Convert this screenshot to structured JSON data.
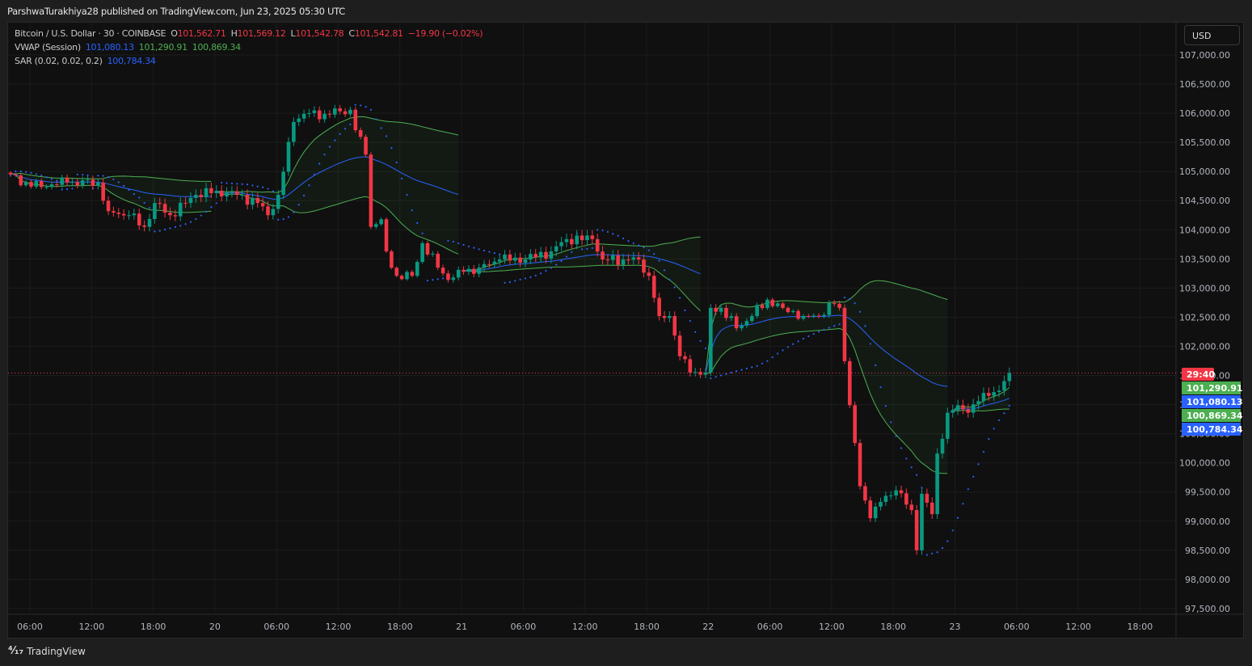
{
  "header": {
    "published": "ParshwaTurakhiya28 published on TradingView.com, Jun 23, 2025 05:30 UTC"
  },
  "legend": {
    "symbol": "Bitcoin / U.S. Dollar · 30 · COINBASE",
    "o_label": "O",
    "o": "101,562.71",
    "h_label": "H",
    "h": "101,569.12",
    "l_label": "L",
    "l": "101,542.78",
    "c_label": "C",
    "c": "101,542.81",
    "change": "−19.90 (−0.02%)",
    "vwap_label": "VWAP (Session)",
    "vwap": "101,080.13",
    "vwap_upper": "101,290.91",
    "vwap_lower": "100,869.34",
    "sar_label": "SAR (0.02, 0.02, 0.2)",
    "sar": "100,784.34"
  },
  "currency_button": "USD",
  "price_tags": {
    "countdown": "29:40",
    "vwap_upper": "101,290.91",
    "vwap": "101,080.13",
    "vwap_lower": "100,869.34",
    "sar": "100,784.34"
  },
  "colors": {
    "up": "#089981",
    "down": "#f23645",
    "vwap": "#2962ff",
    "band": "#4caf50",
    "sar": "#2962ff",
    "bg": "#101010"
  },
  "footer": {
    "brand": "TradingView"
  },
  "chart_data": {
    "type": "candlestick",
    "interval": "30m",
    "ylim": [
      97500,
      107250
    ],
    "y_ticks": [
      "107,000.00",
      "106,500.00",
      "106,000.00",
      "105,500.00",
      "105,000.00",
      "104,500.00",
      "104,000.00",
      "103,500.00",
      "103,000.00",
      "102,500.00",
      "102,000.00",
      "101,500.00",
      "101,000.00",
      "100,500.00",
      "100,000.00",
      "99,500.00",
      "99,000.00",
      "98,500.00",
      "98,000.00",
      "97,500.00"
    ],
    "x_ticks": [
      "06:00",
      "12:00",
      "18:00",
      "20",
      "06:00",
      "12:00",
      "18:00",
      "21",
      "06:00",
      "12:00",
      "18:00",
      "22",
      "06:00",
      "12:00",
      "18:00",
      "23",
      "06:00",
      "12:00",
      "18:00"
    ],
    "session_starts": [
      40,
      88,
      135,
      183
    ],
    "last_price": 101542.81,
    "close_keypoints": [
      [
        0,
        104950
      ],
      [
        4,
        104740
      ],
      [
        11,
        104810
      ],
      [
        17,
        104810
      ],
      [
        19,
        104320
      ],
      [
        23,
        104250
      ],
      [
        26,
        104050
      ],
      [
        28,
        104460
      ],
      [
        31,
        104250
      ],
      [
        36,
        104600
      ],
      [
        40,
        104670
      ],
      [
        44,
        104600
      ],
      [
        48,
        104460
      ],
      [
        50,
        104250
      ],
      [
        52,
        104600
      ],
      [
        55,
        105850
      ],
      [
        57,
        105990
      ],
      [
        61,
        105990
      ],
      [
        66,
        106060
      ],
      [
        67,
        105710
      ],
      [
        69,
        105290
      ],
      [
        70,
        104050
      ],
      [
        72,
        104180
      ],
      [
        73,
        103630
      ],
      [
        75,
        103210
      ],
      [
        78,
        103210
      ],
      [
        80,
        103770
      ],
      [
        83,
        103350
      ],
      [
        85,
        103140
      ],
      [
        88,
        103280
      ],
      [
        91,
        103350
      ],
      [
        95,
        103490
      ],
      [
        100,
        103490
      ],
      [
        105,
        103630
      ],
      [
        108,
        103840
      ],
      [
        113,
        103840
      ],
      [
        115,
        103490
      ],
      [
        119,
        103490
      ],
      [
        122,
        103490
      ],
      [
        124,
        103210
      ],
      [
        126,
        102520
      ],
      [
        128,
        102520
      ],
      [
        130,
        101830
      ],
      [
        132,
        101550
      ],
      [
        135,
        101550
      ],
      [
        136,
        102660
      ],
      [
        138,
        102660
      ],
      [
        141,
        102310
      ],
      [
        144,
        102520
      ],
      [
        147,
        102800
      ],
      [
        150,
        102660
      ],
      [
        154,
        102520
      ],
      [
        157,
        102520
      ],
      [
        160,
        102730
      ],
      [
        161,
        102660
      ],
      [
        163,
        100990
      ],
      [
        165,
        99600
      ],
      [
        167,
        99050
      ],
      [
        169,
        99330
      ],
      [
        172,
        99530
      ],
      [
        175,
        99190
      ],
      [
        176,
        98500
      ],
      [
        177,
        99470
      ],
      [
        179,
        99120
      ],
      [
        180,
        100160
      ],
      [
        182,
        100860
      ],
      [
        184,
        100990
      ],
      [
        186,
        100860
      ],
      [
        189,
        101200
      ],
      [
        192,
        101240
      ],
      [
        194,
        101540
      ]
    ]
  }
}
